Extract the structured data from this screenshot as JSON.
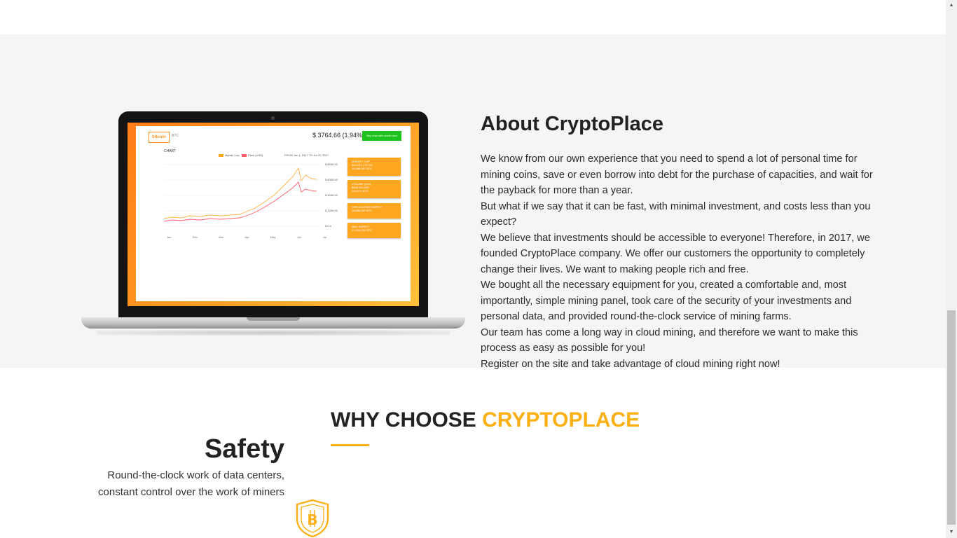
{
  "about": {
    "title": "About CryptoPlace",
    "paragraphs": [
      "We know from our own experience that you need to spend a lot of personal time for mining coins, save or even borrow into debt for the purchase of capacities, and wait for the payback for more than a year.",
      "But what if we say that it can be fast, with minimal investment, and costs less than you expect?",
      "We believe that investments should be accessible to everyone! Therefore, in 2017, we founded CryptoPlace company. We offer our customers the opportunity to completely change their lives. We want to making people rich and free.",
      "We bought all the necessary equipment for you, created a comfortable and, most importantly, simple mining panel, took care of the security of your investments and personal data, and provided round-the-clock service of mining farms.",
      "Our team has come a long way in cloud mining, and therefore we want to make this process as easy as possible for you!",
      "Register on the site and take advantage of cloud mining right now!"
    ]
  },
  "laptop_screen": {
    "logo": "bitcoin",
    "ticker": "BTC",
    "price": "$ 3764.66 (1.94%)",
    "buy_button": "Buy now with credit card",
    "chart_label": "CHART",
    "legend": [
      "Market Cap",
      "Price (USD)"
    ],
    "range": "FROM  Jan 1, 2017   TO  Jul 31, 2017",
    "y_ticks": [
      "$ 8000.00",
      "$ 6000.00",
      "$ 4000.00",
      "$ 2000.00",
      "$ 0.0"
    ],
    "x_ticks": [
      "Jan",
      "Feb",
      "Mar",
      "Apr",
      "May",
      "Jun",
      "Jul"
    ],
    "stats": [
      {
        "label": "MARKET CAP",
        "value": "$63,291,175,327",
        "sub": "16,586,587 BTC"
      },
      {
        "label": "VOLUME (24h)",
        "value": "$808,254,255",
        "sub": "203,271 BTC"
      },
      {
        "label": "CIRCULATING SUPPLY",
        "value": "16,586,587 BTC"
      },
      {
        "label": "MAX SUPPLY",
        "value": "21,000,000 BTC"
      }
    ]
  },
  "why": {
    "title_prefix": "WHY CHOOSE ",
    "title_accent": "CRYPTOPLACE"
  },
  "features": [
    {
      "title": "Safety",
      "description": "Round-the-clock work of data centers, constant control over the work of miners",
      "icon": "bitcoin-shield-icon"
    }
  ],
  "colors": {
    "accent": "#fbb016",
    "section_bg": "#f5f5f5",
    "buy_green": "#1ec21e"
  }
}
